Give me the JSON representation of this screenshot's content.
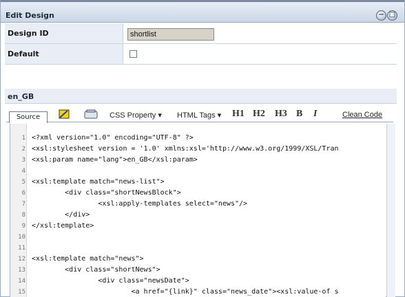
{
  "window": {
    "title": "Edit Design"
  },
  "form": {
    "design_id_label": "Design ID",
    "design_id_value": "shortlist",
    "default_label": "Default",
    "default_checked": false,
    "locale": "en_GB"
  },
  "toolbar": {
    "source_tab": "Source",
    "css_property": "CSS Property",
    "html_tags": "HTML Tags",
    "h1": "H1",
    "h2": "H2",
    "h3": "H3",
    "bold": "B",
    "italic": "I",
    "clean_code": "Clean Code"
  },
  "editor": {
    "lines": [
      {
        "n": "1",
        "text": "<?xml version=\"1.0\" encoding=\"UTF-8\" ?>"
      },
      {
        "n": "2",
        "text": "<xsl:stylesheet version = '1.0' xmlns:xsl='http://www.w3.org/1999/XSL/Tran"
      },
      {
        "n": "3",
        "text": "<xsl:param name=\"lang\">en_GB</xsl:param>"
      },
      {
        "n": "4",
        "text": ""
      },
      {
        "n": "5",
        "text": "<xsl:template match=\"news-list\">"
      },
      {
        "n": "6",
        "text": "        <div class=\"shortNewsBlock\">"
      },
      {
        "n": "7",
        "text": "                <xsl:apply-templates select=\"news\"/>"
      },
      {
        "n": "8",
        "text": "        </div>"
      },
      {
        "n": "9",
        "text": "</xsl:template>"
      },
      {
        "n": "10",
        "text": ""
      },
      {
        "n": "11",
        "text": ""
      },
      {
        "n": "12",
        "text": "<xsl:template match=\"news\">"
      },
      {
        "n": "13",
        "text": "        <div class=\"shortNews\">"
      },
      {
        "n": "14",
        "text": "                <div class=\"newsDate\">"
      },
      {
        "n": "15",
        "text": "                        <a href=\"{link}\" class=\"news_date\"><xsl:value-of s"
      }
    ]
  }
}
